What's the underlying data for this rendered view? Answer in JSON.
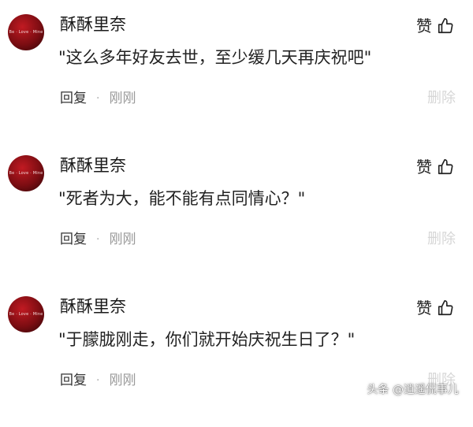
{
  "comments": [
    {
      "avatar_text": "Be · Love · Mine",
      "username": "酥酥里奈",
      "text": "\"这么多年好友去世，至少缓几天再庆祝吧\"",
      "like_label": "赞",
      "reply_label": "回复",
      "separator": "·",
      "time": "刚刚",
      "delete_label": "删除"
    },
    {
      "avatar_text": "Be · Love · Mine",
      "username": "酥酥里奈",
      "text": "\"死者为大，能不能有点同情心？\"",
      "like_label": "赞",
      "reply_label": "回复",
      "separator": "·",
      "time": "刚刚",
      "delete_label": "删除"
    },
    {
      "avatar_text": "Be · Love · Mine",
      "username": "酥酥里奈",
      "text": "\"于朦胧刚走，你们就开始庆祝生日了？\"",
      "like_label": "赞",
      "reply_label": "回复",
      "separator": "·",
      "time": "刚刚",
      "delete_label": "删除"
    }
  ],
  "watermark": "头条 @逍遥侃事儿",
  "colors": {
    "avatar": "#9e141b",
    "text": "#222222",
    "time": "#999999",
    "delete": "#d6d6d6"
  }
}
